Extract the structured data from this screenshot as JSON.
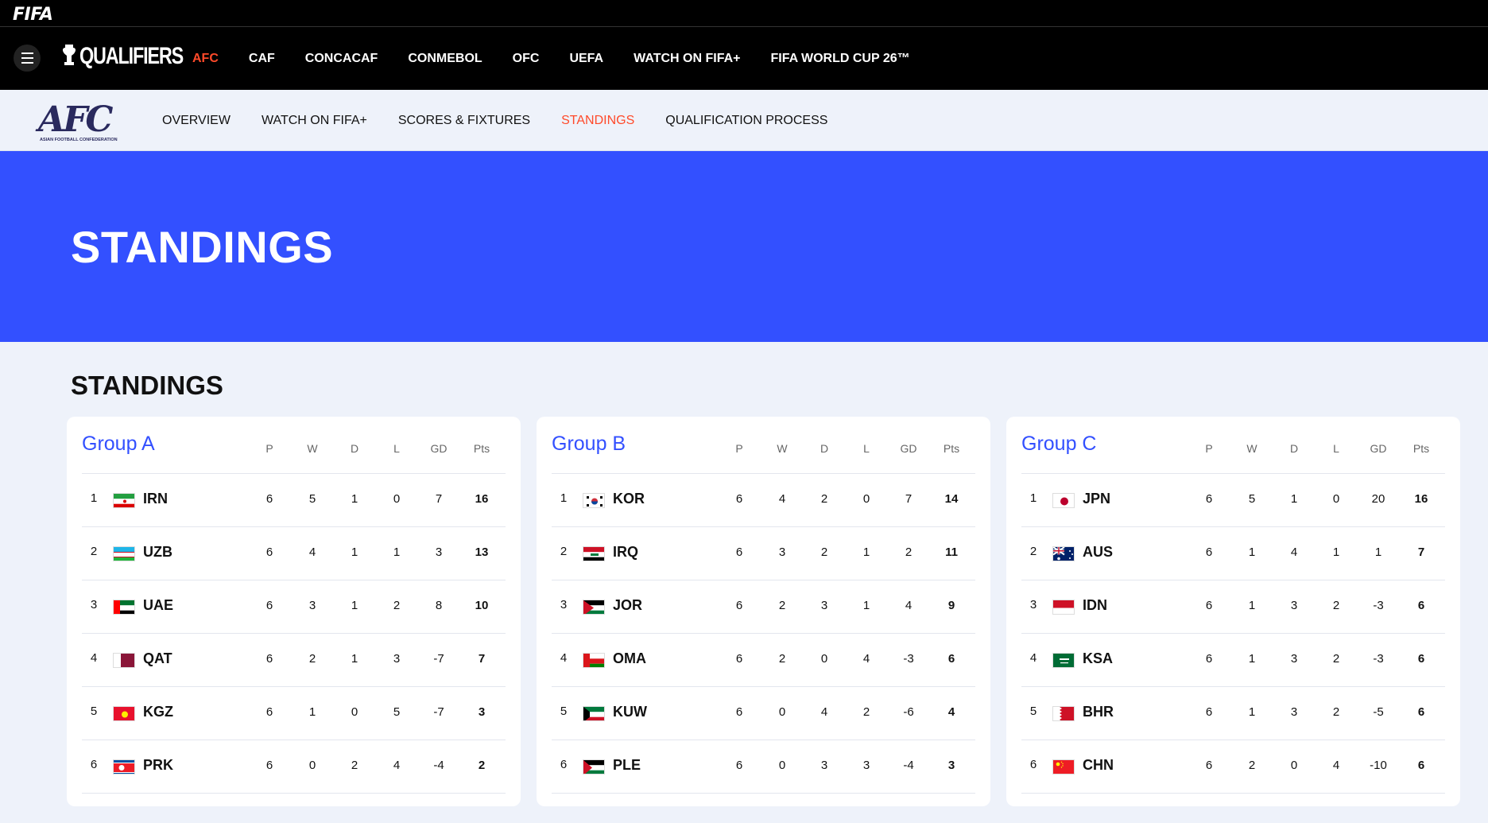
{
  "brand": {
    "fifa": "FIFA",
    "qualifiers": "QUALIFIERS"
  },
  "nav": {
    "items": [
      "AFC",
      "CAF",
      "CONCACAF",
      "CONMEBOL",
      "OFC",
      "UEFA",
      "WATCH ON FIFA+",
      "FIFA WORLD CUP 26™"
    ],
    "active": "AFC"
  },
  "subnav": {
    "logo": "AFC",
    "logo_sub": "ASIAN FOOTBALL CONFEDERATION",
    "items": [
      "OVERVIEW",
      "WATCH ON FIFA+",
      "SCORES & FIXTURES",
      "STANDINGS",
      "QUALIFICATION PROCESS"
    ],
    "active": "STANDINGS"
  },
  "hero": {
    "title": "STANDINGS"
  },
  "section": {
    "title": "STANDINGS"
  },
  "columns": [
    "P",
    "W",
    "D",
    "L",
    "GD",
    "Pts"
  ],
  "colors": {
    "accent": "#ff4a2a",
    "hero_bg": "#3350ff",
    "page_bg": "#eef2fa"
  },
  "groups": [
    {
      "name": "Group A",
      "rows": [
        {
          "rank": "1",
          "team": "IRN",
          "flag": "iran-flag",
          "P": "6",
          "W": "5",
          "D": "1",
          "L": "0",
          "GD": "7",
          "Pts": "16"
        },
        {
          "rank": "2",
          "team": "UZB",
          "flag": "uzbekistan-flag",
          "P": "6",
          "W": "4",
          "D": "1",
          "L": "1",
          "GD": "3",
          "Pts": "13"
        },
        {
          "rank": "3",
          "team": "UAE",
          "flag": "uae-flag",
          "P": "6",
          "W": "3",
          "D": "1",
          "L": "2",
          "GD": "8",
          "Pts": "10"
        },
        {
          "rank": "4",
          "team": "QAT",
          "flag": "qatar-flag",
          "P": "6",
          "W": "2",
          "D": "1",
          "L": "3",
          "GD": "-7",
          "Pts": "7"
        },
        {
          "rank": "5",
          "team": "KGZ",
          "flag": "kyrgyzstan-flag",
          "P": "6",
          "W": "1",
          "D": "0",
          "L": "5",
          "GD": "-7",
          "Pts": "3"
        },
        {
          "rank": "6",
          "team": "PRK",
          "flag": "north-korea-flag",
          "P": "6",
          "W": "0",
          "D": "2",
          "L": "4",
          "GD": "-4",
          "Pts": "2"
        }
      ]
    },
    {
      "name": "Group B",
      "rows": [
        {
          "rank": "1",
          "team": "KOR",
          "flag": "south-korea-flag",
          "P": "6",
          "W": "4",
          "D": "2",
          "L": "0",
          "GD": "7",
          "Pts": "14"
        },
        {
          "rank": "2",
          "team": "IRQ",
          "flag": "iraq-flag",
          "P": "6",
          "W": "3",
          "D": "2",
          "L": "1",
          "GD": "2",
          "Pts": "11"
        },
        {
          "rank": "3",
          "team": "JOR",
          "flag": "jordan-flag",
          "P": "6",
          "W": "2",
          "D": "3",
          "L": "1",
          "GD": "4",
          "Pts": "9"
        },
        {
          "rank": "4",
          "team": "OMA",
          "flag": "oman-flag",
          "P": "6",
          "W": "2",
          "D": "0",
          "L": "4",
          "GD": "-3",
          "Pts": "6"
        },
        {
          "rank": "5",
          "team": "KUW",
          "flag": "kuwait-flag",
          "P": "6",
          "W": "0",
          "D": "4",
          "L": "2",
          "GD": "-6",
          "Pts": "4"
        },
        {
          "rank": "6",
          "team": "PLE",
          "flag": "palestine-flag",
          "P": "6",
          "W": "0",
          "D": "3",
          "L": "3",
          "GD": "-4",
          "Pts": "3"
        }
      ]
    },
    {
      "name": "Group C",
      "rows": [
        {
          "rank": "1",
          "team": "JPN",
          "flag": "japan-flag",
          "P": "6",
          "W": "5",
          "D": "1",
          "L": "0",
          "GD": "20",
          "Pts": "16"
        },
        {
          "rank": "2",
          "team": "AUS",
          "flag": "australia-flag",
          "P": "6",
          "W": "1",
          "D": "4",
          "L": "1",
          "GD": "1",
          "Pts": "7"
        },
        {
          "rank": "3",
          "team": "IDN",
          "flag": "indonesia-flag",
          "P": "6",
          "W": "1",
          "D": "3",
          "L": "2",
          "GD": "-3",
          "Pts": "6"
        },
        {
          "rank": "4",
          "team": "KSA",
          "flag": "saudi-arabia-flag",
          "P": "6",
          "W": "1",
          "D": "3",
          "L": "2",
          "GD": "-3",
          "Pts": "6"
        },
        {
          "rank": "5",
          "team": "BHR",
          "flag": "bahrain-flag",
          "P": "6",
          "W": "1",
          "D": "3",
          "L": "2",
          "GD": "-5",
          "Pts": "6"
        },
        {
          "rank": "6",
          "team": "CHN",
          "flag": "china-flag",
          "P": "6",
          "W": "2",
          "D": "0",
          "L": "4",
          "GD": "-10",
          "Pts": "6"
        }
      ]
    }
  ]
}
